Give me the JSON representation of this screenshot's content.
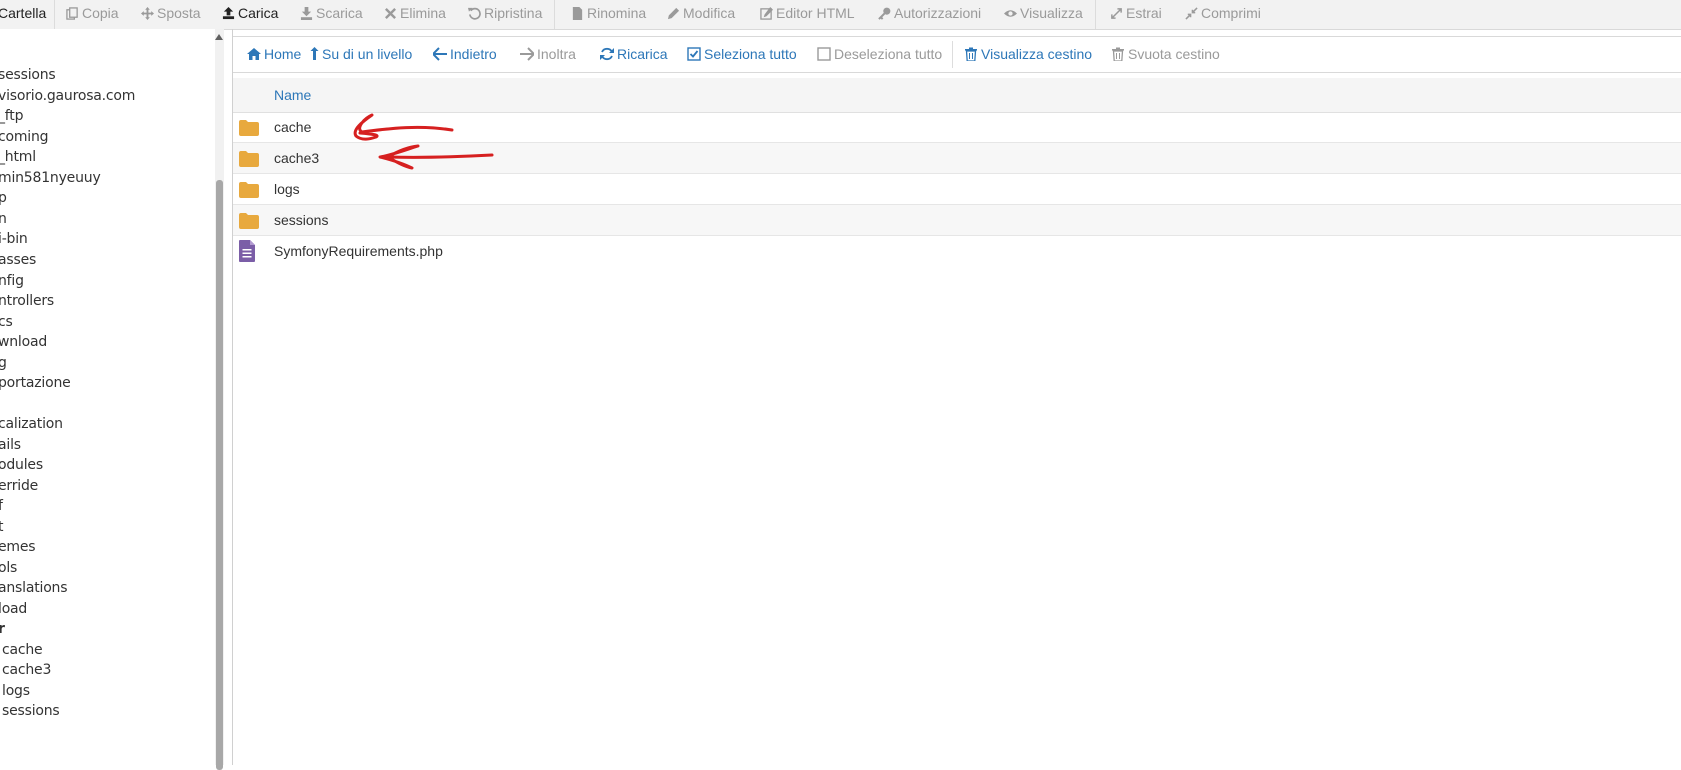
{
  "toolbar": {
    "items": [
      {
        "label": "Cartella",
        "icon": "folder-icon",
        "state": "active"
      },
      {
        "label": "Copia",
        "icon": "copy-icon",
        "state": "disabled"
      },
      {
        "label": "Sposta",
        "icon": "move-icon",
        "state": "disabled"
      },
      {
        "label": "Carica",
        "icon": "upload-icon",
        "state": "active"
      },
      {
        "label": "Scarica",
        "icon": "download-icon",
        "state": "disabled"
      },
      {
        "label": "Elimina",
        "icon": "delete-icon",
        "state": "disabled"
      },
      {
        "label": "Ripristina",
        "icon": "restore-icon",
        "state": "disabled"
      },
      {
        "label": "Rinomina",
        "icon": "rename-icon",
        "state": "disabled"
      },
      {
        "label": "Modifica",
        "icon": "edit-icon",
        "state": "disabled"
      },
      {
        "label": "Editor HTML",
        "icon": "html-editor-icon",
        "state": "disabled"
      },
      {
        "label": "Autorizzazioni",
        "icon": "key-icon",
        "state": "disabled"
      },
      {
        "label": "Visualizza",
        "icon": "eye-icon",
        "state": "disabled"
      },
      {
        "label": "Estrai",
        "icon": "expand-icon",
        "state": "disabled"
      },
      {
        "label": "Comprimi",
        "icon": "compress-icon",
        "state": "disabled"
      }
    ]
  },
  "tree": {
    "items": [
      {
        "label": "sessions"
      },
      {
        "label": "visorio.gaurosa.com"
      },
      {
        "label": "_ftp"
      },
      {
        "label": "coming"
      },
      {
        "label": "_html"
      },
      {
        "label": "min581nyeuuy"
      },
      {
        "label": "p"
      },
      {
        "label": "n"
      },
      {
        "label": "i-bin"
      },
      {
        "label": "asses"
      },
      {
        "label": "nfig"
      },
      {
        "label": "ntrollers"
      },
      {
        "label": "cs"
      },
      {
        "label": "wnload"
      },
      {
        "label": "g"
      },
      {
        "label": "portazione"
      },
      {
        "label": ""
      },
      {
        "label": "calization"
      },
      {
        "label": "ails"
      },
      {
        "label": "odules"
      },
      {
        "label": "erride"
      },
      {
        "label": "f"
      },
      {
        "label": "t"
      },
      {
        "label": "emes"
      },
      {
        "label": "ols"
      },
      {
        "label": "anslations"
      },
      {
        "label": "load"
      },
      {
        "label": "r",
        "bold": true
      },
      {
        "label": "cache"
      },
      {
        "label": "cache3"
      },
      {
        "label": "logs"
      },
      {
        "label": "sessions"
      }
    ]
  },
  "actions": {
    "items": [
      {
        "label": "Home",
        "icon": "home-icon",
        "enabled": true
      },
      {
        "label": "Su di un livello",
        "icon": "level-up-icon",
        "enabled": true
      },
      {
        "label": "Indietro",
        "icon": "arrow-left-icon",
        "enabled": true
      },
      {
        "label": "Inoltra",
        "icon": "arrow-right-icon",
        "enabled": false
      },
      {
        "label": "Ricarica",
        "icon": "refresh-icon",
        "enabled": true
      },
      {
        "label": "Seleziona tutto",
        "icon": "checked-box-icon",
        "enabled": true
      },
      {
        "label": "Deseleziona tutto",
        "icon": "empty-box-icon",
        "enabled": false
      },
      {
        "label": "Visualizza cestino",
        "icon": "trash-icon",
        "enabled": true
      },
      {
        "label": "Svuota cestino",
        "icon": "trash-icon",
        "enabled": false
      }
    ]
  },
  "filelist": {
    "column_name": "Name",
    "rows": [
      {
        "name": "cache",
        "type": "folder"
      },
      {
        "name": "cache3",
        "type": "folder"
      },
      {
        "name": "logs",
        "type": "folder"
      },
      {
        "name": "sessions",
        "type": "folder"
      },
      {
        "name": "SymfonyRequirements.php",
        "type": "file"
      }
    ]
  },
  "colors": {
    "link": "#2d77b8",
    "folder": "#e8a93e",
    "file": "#7b5ea7",
    "annotation": "#d62020"
  }
}
